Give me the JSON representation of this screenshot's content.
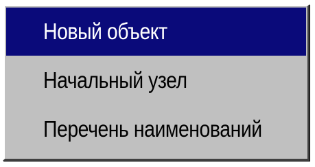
{
  "menu": {
    "items": [
      {
        "label": "Новый объект",
        "state": "highlighted"
      },
      {
        "label": "Начальный узел",
        "state": "normal"
      },
      {
        "label": "Перечень наименований",
        "state": "normal"
      }
    ]
  },
  "colors": {
    "menu_background": "#c0c0c0",
    "highlight_background": "#0a0a7a",
    "highlight_text": "#ffffff",
    "normal_text": "#000000"
  }
}
